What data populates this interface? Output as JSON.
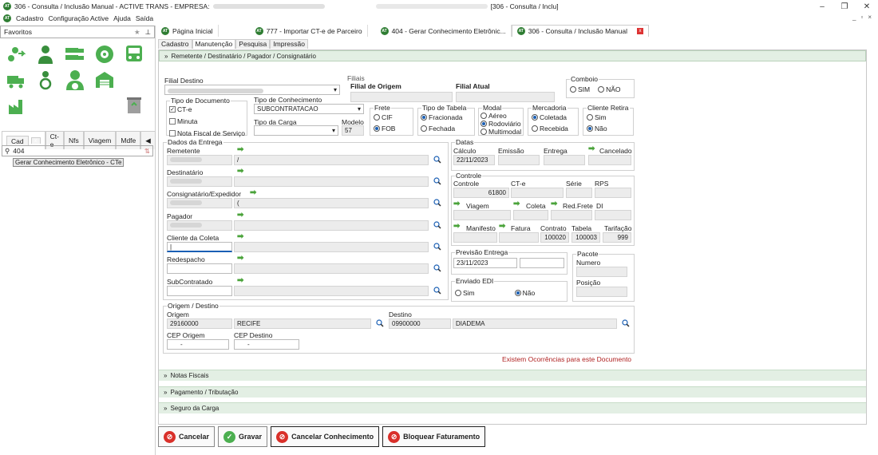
{
  "window": {
    "title": "306 - Consulta / Inclusão Manual - ACTIVE TRANS - EMPRESA:",
    "title_right": "[306 - Consulta / Inclu]",
    "logo": "AT"
  },
  "menu": [
    "Cadastro",
    "Configuração Active",
    "Ajuda",
    "Saída"
  ],
  "left": {
    "favorites_label": "Favoritos",
    "tabs": [
      "Cad",
      "Ct-e",
      "Nfs",
      "Viagem",
      "Mdfe"
    ],
    "search_value": "404",
    "search_result": "Gerar Conhecimento Eletrônico - CTe",
    "icons": [
      "route-icon",
      "user-icon",
      "trucks-icon",
      "tire-icon",
      "bus-icon",
      "truck-icon",
      "driver-icon",
      "driver-wheel-icon",
      "warehouse-icon",
      "empty-icon",
      "factory-icon",
      "empty-icon",
      "empty-icon",
      "empty-icon",
      "recycle-bin-icon"
    ]
  },
  "tabs": [
    {
      "label": "Página Inicial"
    },
    {
      "label": "777 - Importar CT-e de Parceiro"
    },
    {
      "label": "404 - Gerar Conhecimento Eletrônic..."
    },
    {
      "label": "306 - Consulta / Inclusão Manual"
    }
  ],
  "subtabs": [
    "Cadastro",
    "Manutenção",
    "Pesquisa",
    "Impressão"
  ],
  "section_header": "Remetente / Destinatário / Pagador / Consignatário",
  "form": {
    "filial_destino_label": "Filial Destino",
    "filiais_title": "Filiais",
    "filial_origem": "Filial de Origem",
    "filial_atual": "Filial Atual",
    "comboio_title": "Comboio",
    "comboio_sim": "SIM",
    "comboio_nao": "NÃO",
    "tipo_doc_title": "Tipo de Documento",
    "doc_cte": "CT-e",
    "doc_minuta": "Minuta",
    "doc_nf": "Nota Fiscal de Serviço",
    "tipo_conhec_title": "Tipo de Conhecimento",
    "tipo_conhec_value": "SUBCONTRATACAO",
    "tipo_carga_title": "Tipo da Carga",
    "modelo_label": "Modelo",
    "modelo_value": "57",
    "frete_title": "Frete",
    "frete_cif": "CIF",
    "frete_fob": "FOB",
    "tabela_title": "Tipo de Tabela",
    "tabela_frac": "Fracionada",
    "tabela_fech": "Fechada",
    "modal_title": "Modal",
    "modal_aereo": "Aéreo",
    "modal_rodo": "Rodoviário",
    "modal_multi": "Multimodal",
    "merc_title": "Mercadoria",
    "merc_col": "Coletada",
    "merc_rec": "Recebida",
    "cliente_retira_title": "Cliente Retira",
    "cr_sim": "Sim",
    "cr_nao": "Não"
  },
  "entrega": {
    "title": "Dados da Entrega",
    "fields": [
      {
        "label": "Remetente",
        "value": "/"
      },
      {
        "label": "Destinatário",
        "value": ""
      },
      {
        "label": "Consignatário/Expedidor",
        "value": "("
      },
      {
        "label": "Pagador",
        "value": ""
      },
      {
        "label": "Cliente da Coleta",
        "value": ""
      },
      {
        "label": "Redespacho",
        "value": ""
      },
      {
        "label": "SubContratado",
        "value": ""
      }
    ]
  },
  "datas": {
    "title": "Datas",
    "calculo": "Cálculo",
    "emissao": "Emissão",
    "entrega": "Entrega",
    "cancelado": "Cancelado",
    "calculo_value": "22/11/2023"
  },
  "controle": {
    "title": "Controle",
    "controle": "Controle",
    "cte": "CT-e",
    "serie": "Série",
    "rps": "RPS",
    "controle_value": "61800",
    "viagem": "Viagem",
    "coleta": "Coleta",
    "redfrete": "Red.Frete",
    "di": "DI",
    "manifesto": "Manifesto",
    "fatura": "Fatura",
    "contrato": "Contrato",
    "tabela": "Tabela",
    "tarifacao": "Tarifação",
    "contrato_value": "100020",
    "tabela_value": "100003",
    "tarifacao_value": "999"
  },
  "previsao": {
    "title": "Previsão Entrega",
    "value": "23/11/2023"
  },
  "pacote": {
    "title": "Pacote",
    "numero": "Numero",
    "posicao": "Posição"
  },
  "edi": {
    "title": "Enviado EDI",
    "sim": "Sim",
    "nao": "Não"
  },
  "origem": {
    "title": "Origem / Destino",
    "origem_label": "Origem",
    "origem_cep": "29160000",
    "origem_city": "RECIFE",
    "destino_label": "Destino",
    "destino_cep": "09900000",
    "destino_city": "DIADEMA",
    "cep_origem_label": "CEP Origem",
    "cep_origem_value": "-",
    "cep_destino_label": "CEP Destino",
    "cep_destino_value": "-"
  },
  "ocorrencias": "Existem Ocorrências para este Documento",
  "collapsed": [
    "Notas Fiscais",
    "Pagamento / Tributação",
    "Seguro da Carga"
  ],
  "buttons": {
    "cancelar": "Cancelar",
    "gravar": "Gravar",
    "cancelar_conhec": "Cancelar Conhecimento",
    "bloquear": "Bloquear Faturamento"
  }
}
